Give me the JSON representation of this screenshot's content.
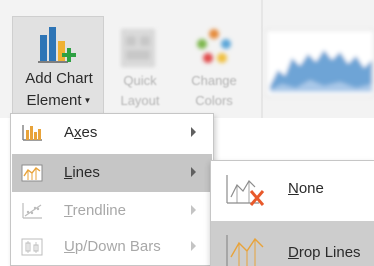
{
  "ribbon": {
    "add_chart_element": {
      "line1": "Add Chart",
      "line2": "Element"
    },
    "quick_layout": {
      "line1": "Quick",
      "line2": "Layout"
    },
    "change_colors": {
      "line1": "Change",
      "line2": "Colors"
    }
  },
  "menu": {
    "items": [
      {
        "pre": "A",
        "acc": "x",
        "post": "es",
        "icon": "axes-icon",
        "state": "normal"
      },
      {
        "pre": "",
        "acc": "L",
        "post": "ines",
        "icon": "lines-icon",
        "state": "active"
      },
      {
        "pre": "",
        "acc": "T",
        "post": "rendline",
        "icon": "trendline-icon",
        "state": "disabled"
      },
      {
        "pre": "",
        "acc": "U",
        "post": "p/Down Bars",
        "icon": "up-down-bars-icon",
        "state": "disabled"
      }
    ]
  },
  "submenu": {
    "items": [
      {
        "pre": "",
        "acc": "N",
        "post": "one",
        "icon": "no-lines-icon"
      },
      {
        "pre": "",
        "acc": "D",
        "post": "rop Lines",
        "icon": "drop-lines-icon"
      }
    ]
  }
}
